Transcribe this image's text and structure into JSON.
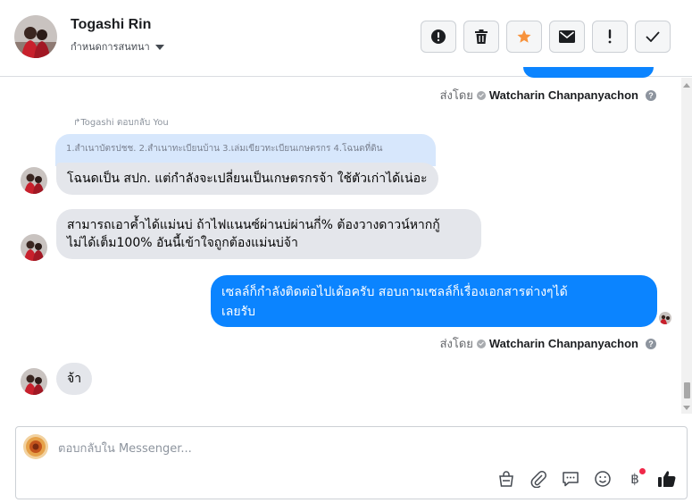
{
  "header": {
    "name": "Togashi Rin",
    "subtitle": "กำหนดการสนทนา",
    "toolbar": [
      {
        "id": "spam",
        "icon": "alert-circle-icon"
      },
      {
        "id": "delete",
        "icon": "trash-icon"
      },
      {
        "id": "star",
        "icon": "star-icon",
        "color": "#f7923b"
      },
      {
        "id": "mail",
        "icon": "envelope-icon"
      },
      {
        "id": "important",
        "icon": "exclamation-icon"
      },
      {
        "id": "done",
        "icon": "checkmark-icon"
      }
    ]
  },
  "conversation": {
    "sent_by_prefix": "ส่งโดย",
    "sent_by_name": "Watcharin Chanpanyachon",
    "help": "?",
    "reply_label": "↱Togashi ตอบกลับ You",
    "quoted_text": "1.สำเนาบัตรปชช. 2.สำเนาทะเบียนบ้าน 3.เล่มเขียวทะเบียนเกษตรกร 4.โฉนดที่ดิน",
    "messages": [
      {
        "dir": "in",
        "text": "โฉนดเป็น สปก. แต่กำลังจะเปลี่ยนเป็นเกษตรกรจ้า ใช้ตัวเก่าได้เน่อะ"
      },
      {
        "dir": "in",
        "line1": "สามารถเอาค้ำได้แม่นบ่ ถ้าไฟแนนซ์ผ่านบ่ผ่านกี่% ต้องวางดาวน์หากกู้",
        "line2": "ไม่ได้เต็ม100% อันนี้เข้าใจถูกต้องแม่นบ่จ้า"
      },
      {
        "dir": "out",
        "line1": "เซลล์ก็กำลังติดต่อไปเด้อครับ สอบถามเซลล์ก็เรื่องเอกสารต่างๆได้",
        "line2": "เลยรับ"
      },
      {
        "dir": "in",
        "text": "จ้า"
      }
    ],
    "outgoing_color": "#0b84ff"
  },
  "composer": {
    "placeholder": "ตอบกลับใน Messenger...",
    "tools": [
      "bag-icon",
      "paperclip-icon",
      "speech-bubble-icon",
      "smiley-icon",
      "baht-icon",
      "thumbs-up-icon"
    ],
    "baht_symbol": "฿"
  }
}
